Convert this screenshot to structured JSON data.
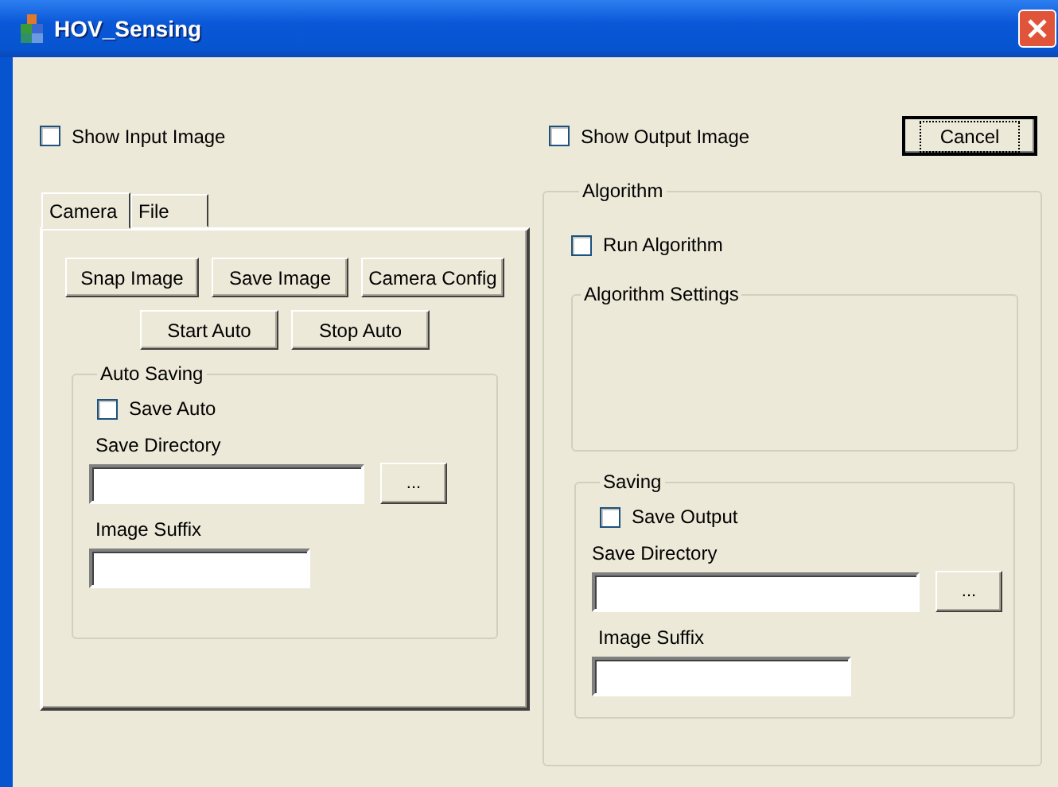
{
  "window": {
    "title": "HOV_Sensing"
  },
  "show_input_image": {
    "label": "Show Input Image",
    "checked": false
  },
  "show_output_image": {
    "label": "Show Output Image",
    "checked": false
  },
  "cancel_button": "Cancel",
  "tabs": [
    {
      "label": "Camera",
      "selected": true
    },
    {
      "label": "File",
      "selected": false
    }
  ],
  "camera_button_rows": [
    {
      "buttons": [
        "Snap Image",
        "Save Image",
        "Camera Config"
      ]
    },
    {
      "buttons": [
        "Start Auto",
        "Stop Auto"
      ]
    }
  ],
  "auto_saving": {
    "title": "Auto Saving",
    "save_auto": {
      "label": "Save Auto",
      "checked": false
    },
    "directory_label": "Save Directory",
    "browse_button": "...",
    "suffix_label": "Image Suffix"
  },
  "algorithm": {
    "title": "Algorithm",
    "run_algorithm": {
      "label": "Run Algorithm",
      "checked": false
    },
    "settings_title": "Algorithm Settings",
    "saving": {
      "title": "Saving",
      "save_output": {
        "label": "Save Output",
        "checked": false
      },
      "directory_label": "Save Directory",
      "browse_button": "...",
      "suffix_label": "Image Suffix"
    }
  }
}
